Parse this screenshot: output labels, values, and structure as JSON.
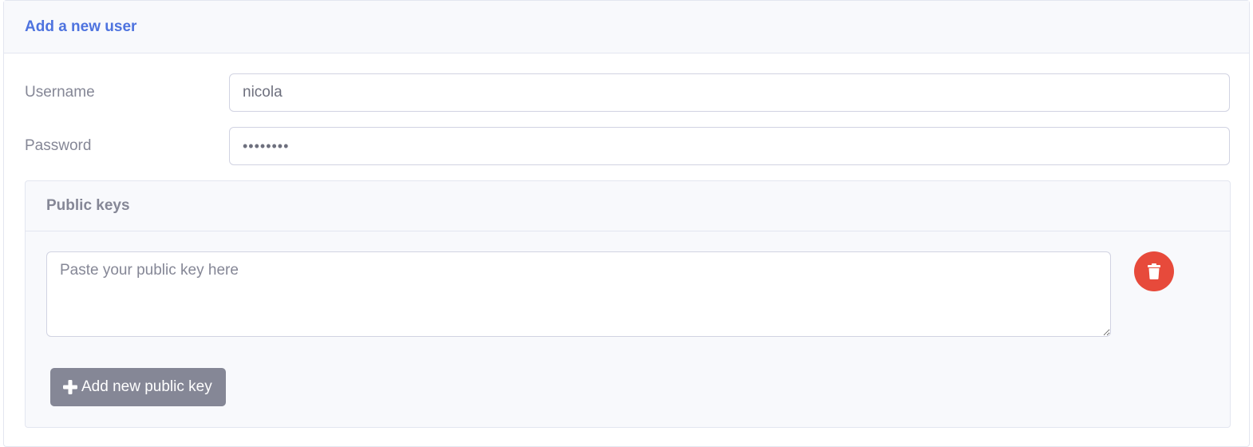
{
  "card": {
    "title": "Add a new user"
  },
  "form": {
    "username": {
      "label": "Username",
      "value": "nicola"
    },
    "password": {
      "label": "Password",
      "value": "••••••••"
    }
  },
  "public_keys": {
    "title": "Public keys",
    "textarea_placeholder": "Paste your public key here",
    "delete_icon": "trash-icon",
    "add_button_label": "Add new public key",
    "add_icon": "plus-icon"
  },
  "colors": {
    "primary": "#4e73df",
    "danger": "#e74a3b",
    "secondary": "#858796"
  }
}
